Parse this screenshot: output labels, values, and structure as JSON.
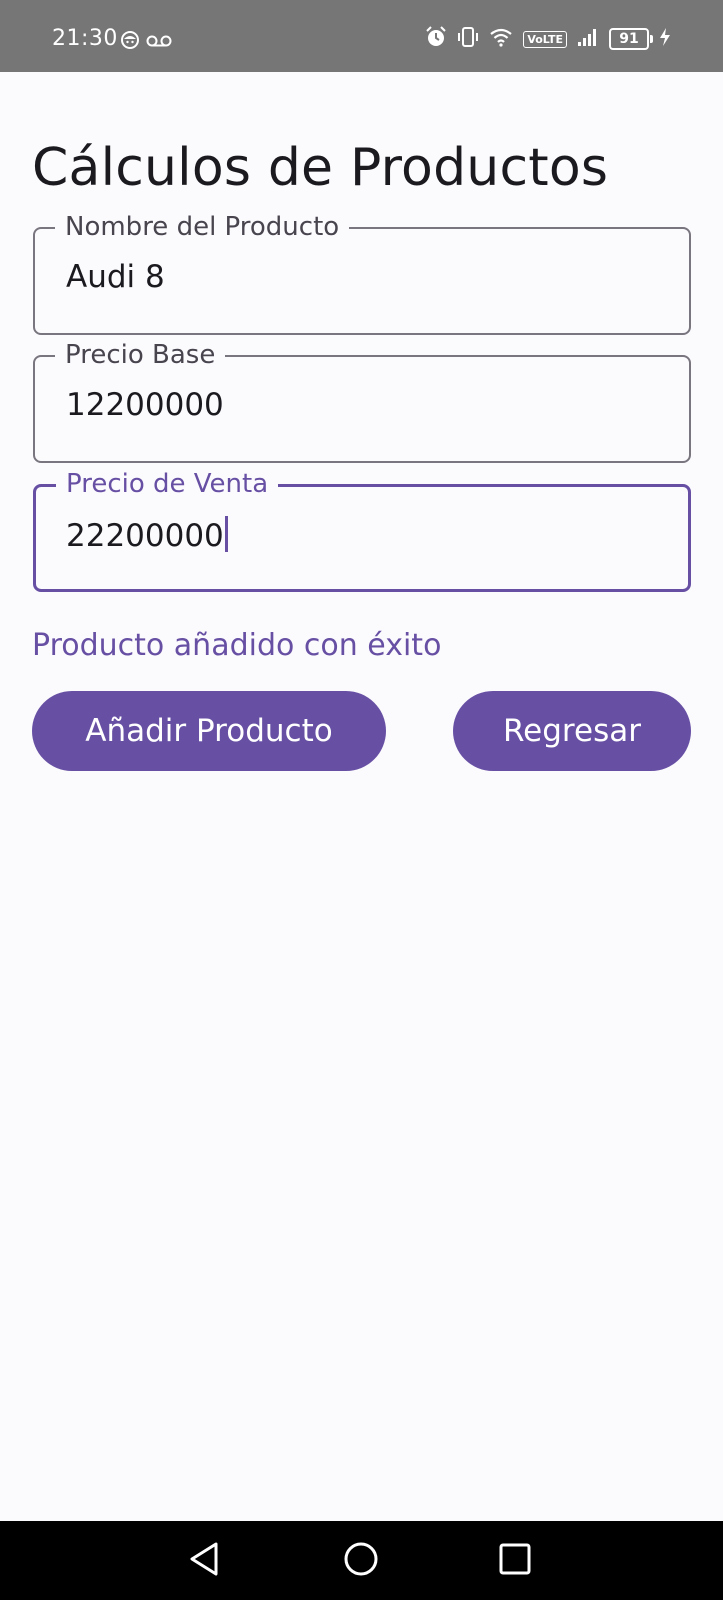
{
  "status_bar": {
    "time": "21:30",
    "volte": "VoLTE",
    "battery": "91",
    "icons": [
      "notification-face-icon",
      "voicemail-icon",
      "alarm-icon",
      "vibrate-icon",
      "wifi-icon",
      "volte-icon",
      "signal-icon",
      "battery-icon",
      "charging-icon"
    ]
  },
  "page": {
    "title": "Cálculos de Productos"
  },
  "form": {
    "product_name": {
      "label": "Nombre del Producto",
      "value": "Audi 8"
    },
    "base_price": {
      "label": "Precio Base",
      "value": "12200000"
    },
    "sale_price": {
      "label": "Precio de Venta",
      "value": "22200000"
    }
  },
  "message": "Producto añadido con éxito",
  "buttons": {
    "add_label": "Añadir Producto",
    "back_label": "Regresar"
  },
  "nav_bar": {
    "icons": [
      "back-icon",
      "home-icon",
      "recents-icon"
    ]
  },
  "colors": {
    "accent": "#6750a4",
    "background": "#fbfafd",
    "status_bar": "#767676",
    "nav_bar": "#000000"
  }
}
